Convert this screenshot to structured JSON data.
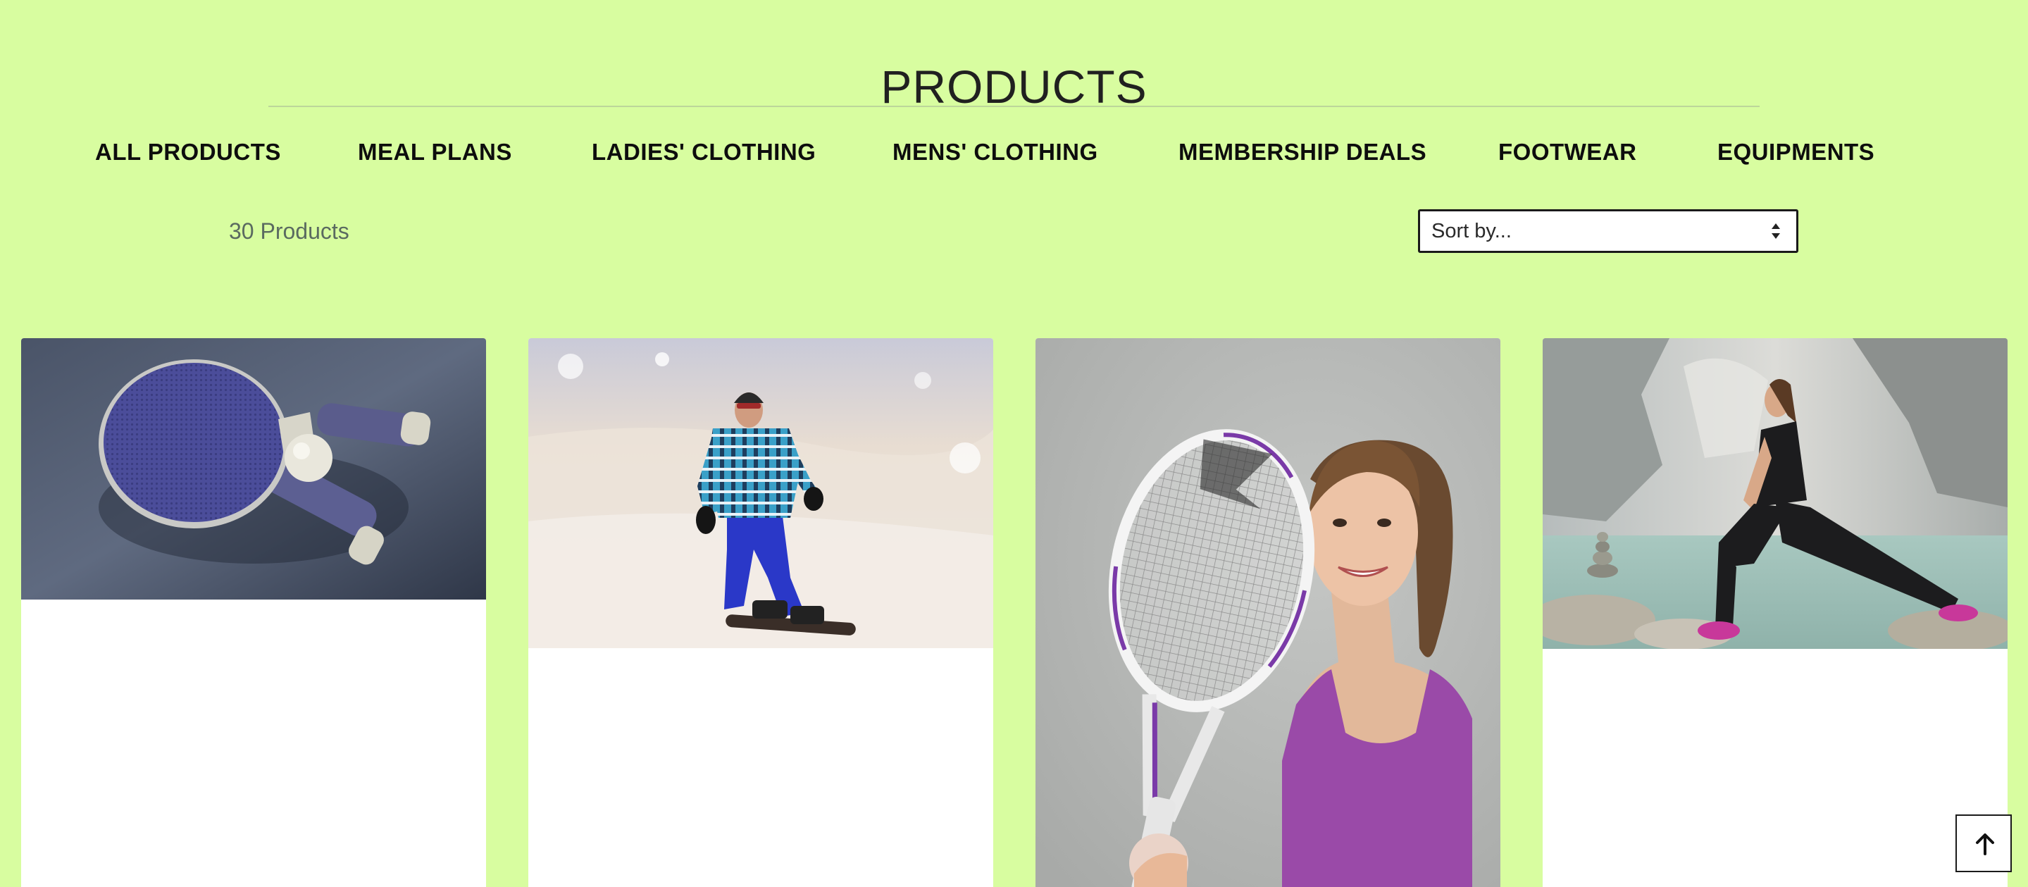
{
  "page": {
    "title": "PRODUCTS",
    "background_color": "#d8fda0"
  },
  "nav": {
    "items": [
      {
        "label": "ALL PRODUCTS"
      },
      {
        "label": "MEAL PLANS"
      },
      {
        "label": "LADIES' CLOTHING"
      },
      {
        "label": "MENS' CLOTHING"
      },
      {
        "label": "MEMBERSHIP DEALS"
      },
      {
        "label": "FOOTWEAR"
      },
      {
        "label": "EQUIPMENTS"
      }
    ]
  },
  "toolbar": {
    "product_count": "30 Products",
    "sort_select": {
      "selected": "Sort by..."
    }
  },
  "products": [
    {
      "image": "ping-pong-paddles-photo"
    },
    {
      "image": "snowboarder-photo"
    },
    {
      "image": "woman-with-tennis-racket-photo"
    },
    {
      "image": "woman-stretching-by-river-photo"
    }
  ],
  "scroll_top": {
    "icon": "arrow-up-icon"
  }
}
